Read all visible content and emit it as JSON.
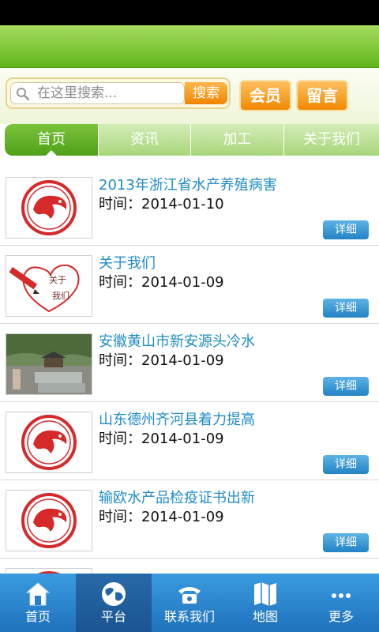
{
  "search": {
    "placeholder": "在这里搜索...",
    "button_label": "搜索"
  },
  "header_buttons": {
    "member": "会员",
    "message": "留言"
  },
  "tabs": [
    {
      "label": "首页",
      "active": true
    },
    {
      "label": "资讯",
      "active": false
    },
    {
      "label": "加工",
      "active": false
    },
    {
      "label": "关于我们",
      "active": false
    }
  ],
  "list": {
    "time_label": "时间：",
    "detail_label": "详细",
    "items": [
      {
        "title": "2013年浙江省水产养殖病害",
        "date": "2014-01-10",
        "thumb_icon": "red-fish-logo"
      },
      {
        "title": "关于我们",
        "date": "2014-01-09",
        "thumb_icon": "pencil-heart"
      },
      {
        "title": "安徽黄山市新安源头冷水",
        "date": "2014-01-09",
        "thumb_icon": "fish-pond-photo"
      },
      {
        "title": "山东德州齐河县着力提高",
        "date": "2014-01-09",
        "thumb_icon": "red-fish-logo"
      },
      {
        "title": "输欧水产品检疫证书出新",
        "date": "2014-01-09",
        "thumb_icon": "red-fish-logo"
      }
    ]
  },
  "bottom_nav": [
    {
      "label": "首页",
      "icon": "home-icon",
      "active": false
    },
    {
      "label": "平台",
      "icon": "globe-icon",
      "active": true
    },
    {
      "label": "联系我们",
      "icon": "phone-icon",
      "active": false
    },
    {
      "label": "地图",
      "icon": "map-icon",
      "active": false
    },
    {
      "label": "更多",
      "icon": "more-icon",
      "active": false
    }
  ],
  "colors": {
    "header_green": "#5fb61b",
    "tab_active": "#4ea118",
    "title_blue": "#1f8cc8",
    "button_orange": "#f08600",
    "nav_blue": "#1f72bd"
  }
}
